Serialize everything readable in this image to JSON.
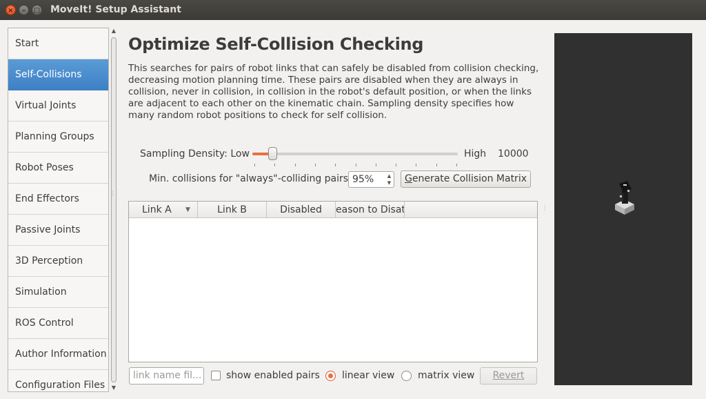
{
  "window": {
    "title": "MoveIt! Setup Assistant"
  },
  "nav": {
    "items": [
      {
        "label": "Start"
      },
      {
        "label": "Self-Collisions",
        "active": true
      },
      {
        "label": "Virtual Joints"
      },
      {
        "label": "Planning Groups"
      },
      {
        "label": "Robot Poses"
      },
      {
        "label": "End Effectors"
      },
      {
        "label": "Passive Joints"
      },
      {
        "label": "3D Perception"
      },
      {
        "label": "Simulation"
      },
      {
        "label": "ROS Control"
      },
      {
        "label": "Author Information"
      },
      {
        "label": "Configuration Files"
      }
    ]
  },
  "page": {
    "title": "Optimize Self-Collision Checking",
    "description": "This searches for pairs of robot links that can safely be disabled from collision checking, decreasing motion planning time. These pairs are disabled when they are always in collision, never in collision, in collision in the robot's default position, or when the links are adjacent to each other on the kinematic chain. Sampling density specifies how many random robot positions to check for self collision."
  },
  "sampling": {
    "label": "Sampling Density: Low",
    "high_label": "High",
    "value_text": "10000",
    "level_fraction": 0.1
  },
  "min_collisions": {
    "label": "Min. collisions for \"always\"-colliding pairs:",
    "value": "95%",
    "generate_button_rest": "enerate Collision Matrix",
    "generate_button_mnemonic": "G"
  },
  "table": {
    "columns": [
      "Link A",
      "Link B",
      "Disabled",
      "eason to Disat"
    ]
  },
  "footer": {
    "filter_placeholder": "link name fil...",
    "show_enabled_label": "show enabled pairs",
    "linear_view_label": "linear view",
    "matrix_view_label": "matrix view",
    "revert_label": "Revert",
    "linear_view_selected": true,
    "show_enabled_checked": false
  },
  "colors": {
    "accent": "#e96f3f",
    "nav_active": "#4a8cd0",
    "viewer_bg": "#303030"
  }
}
